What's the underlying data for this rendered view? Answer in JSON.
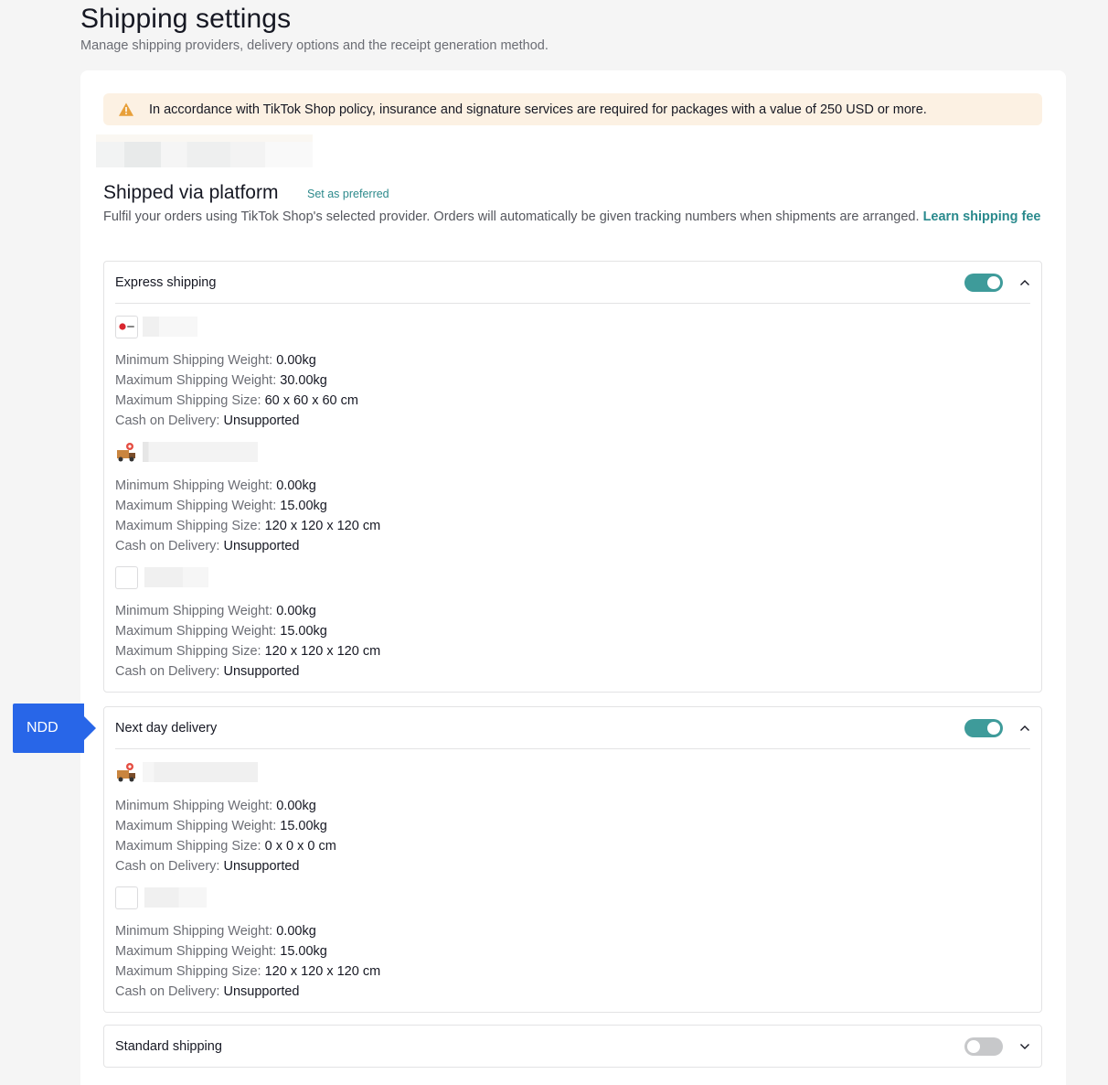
{
  "page": {
    "title": "Shipping settings",
    "subtitle": "Manage shipping providers, delivery options and the receipt generation method."
  },
  "notice": {
    "text": "In accordance with TikTok Shop policy, insurance and signature services are required for packages with a value of 250 USD or more.",
    "icon": "warning-icon",
    "color": "#fcf1e3"
  },
  "platform": {
    "title": "Shipped via platform",
    "preferred_link": "Set as preferred",
    "description": "Fulfil your orders using TikTok Shop's selected provider. Orders will automatically be given tracking numbers when shipments are arranged.",
    "learn_link": "Learn shipping fee"
  },
  "spec_labels": {
    "min_weight": "Minimum Shipping Weight:",
    "max_weight": "Maximum Shipping Weight:",
    "max_size": "Maximum Shipping Size:",
    "cod": "Cash on Delivery:"
  },
  "groups": {
    "express": {
      "label": "Express shipping",
      "enabled": true,
      "providers": [
        {
          "logo": "dpd-logo-icon",
          "min_weight": "0.00kg",
          "max_weight": "30.00kg",
          "max_size": "60 x 60 x 60 cm",
          "cod": "Unsupported"
        },
        {
          "logo": "delivery-truck-icon",
          "min_weight": "0.00kg",
          "max_weight": "15.00kg",
          "max_size": "120 x 120 x 120 cm",
          "cod": "Unsupported"
        },
        {
          "logo": "blank-logo-icon",
          "min_weight": "0.00kg",
          "max_weight": "15.00kg",
          "max_size": "120 x 120 x 120 cm",
          "cod": "Unsupported"
        }
      ]
    },
    "next_day": {
      "label": "Next day delivery",
      "enabled": true,
      "providers": [
        {
          "logo": "delivery-truck-icon",
          "min_weight": "0.00kg",
          "max_weight": "15.00kg",
          "max_size": "0 x 0 x 0 cm",
          "cod": "Unsupported"
        },
        {
          "logo": "blank-logo-icon",
          "min_weight": "0.00kg",
          "max_weight": "15.00kg",
          "max_size": "120 x 120 x 120 cm",
          "cod": "Unsupported"
        }
      ]
    },
    "standard": {
      "label": "Standard shipping",
      "enabled": false
    }
  },
  "annotation": {
    "ndd": "NDD",
    "color": "#2866e8"
  },
  "colors": {
    "accent": "#3e9b9a",
    "link": "#2a8a8d"
  }
}
